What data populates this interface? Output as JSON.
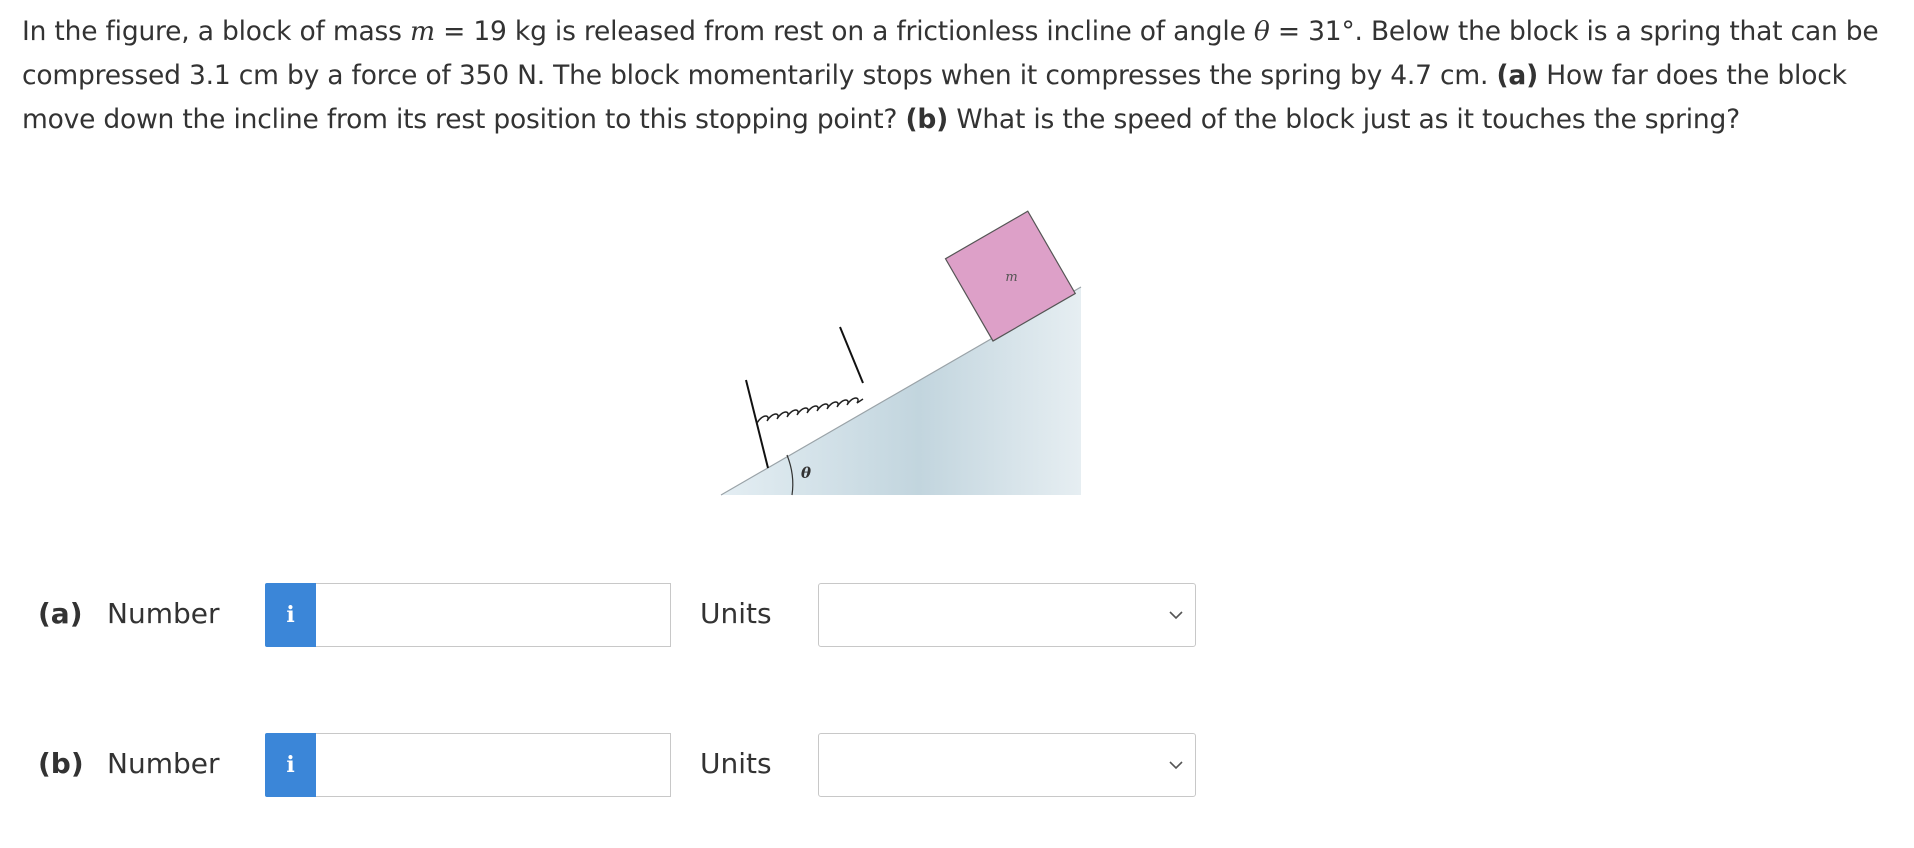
{
  "question": {
    "p1": "In the figure, a block of mass ",
    "m_sym": "m",
    "p2": " = 19 kg is released from rest on a frictionless incline of angle ",
    "theta_sym": "θ",
    "p3": " = 31°. Below the block is a spring that can be compressed 3.1 cm by a force of 350 N. The block momentarily stops when it compresses the spring by 4.7 cm. ",
    "a_tag": "(a)",
    "p4": " How far does the block move down the incline from its rest position to this stopping point? ",
    "b_tag": "(b)",
    "p5": " What is the speed of the block just as it touches the spring?"
  },
  "figure": {
    "block_label": "m",
    "angle_label": "θ",
    "colors": {
      "block": "#dda0c8",
      "incline": "#d4e1e8",
      "spring": "#222222"
    }
  },
  "answers": [
    {
      "tag": "(a)",
      "number_label": "Number",
      "info_icon": "i",
      "value": "",
      "units_label": "Units",
      "units_value": ""
    },
    {
      "tag": "(b)",
      "number_label": "Number",
      "info_icon": "i",
      "value": "",
      "units_label": "Units",
      "units_value": ""
    }
  ],
  "colors": {
    "info_button": "#3b86d8",
    "text": "#333333",
    "border": "#c8c8c8"
  }
}
